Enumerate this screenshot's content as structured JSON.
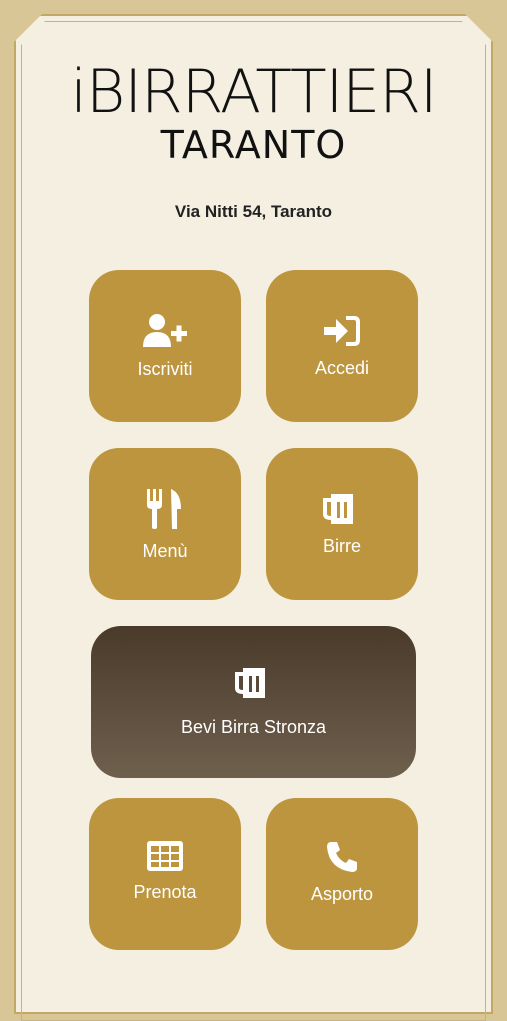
{
  "brand": {
    "name": "iBIRRATTIERI",
    "city": "TARANTO"
  },
  "address": "Via Nitti 54, Taranto",
  "tiles": {
    "iscriviti": {
      "label": "Iscriviti",
      "icon": "user-plus-icon"
    },
    "accedi": {
      "label": "Accedi",
      "icon": "sign-in-icon"
    },
    "menu": {
      "label": "Menù",
      "icon": "utensils-icon"
    },
    "birre": {
      "label": "Birre",
      "icon": "beer-mug-icon"
    },
    "bevi": {
      "label": "Bevi Birra Stronza",
      "icon": "beer-mug-icon"
    },
    "prenota": {
      "label": "Prenota",
      "icon": "calendar-grid-icon"
    },
    "asporto": {
      "label": "Asporto",
      "icon": "phone-icon"
    }
  },
  "colors": {
    "tile": "#bc953e",
    "background": "#f4efe1",
    "frame": "#d8c697",
    "dark_tile_top": "#4a3a2a",
    "dark_tile_bottom": "#6f5f4d"
  }
}
